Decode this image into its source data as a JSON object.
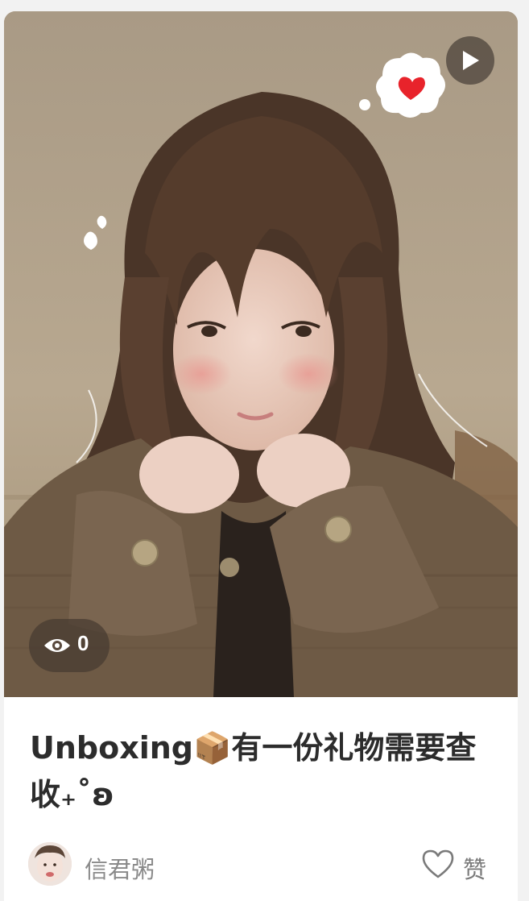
{
  "post": {
    "title": "Unboxing📦有一份礼物需要查收₊˚ʚ",
    "views": "0",
    "author_name": "信君粥",
    "like_label": "赞"
  },
  "icons": {
    "play": "play-icon",
    "views": "eye-icon",
    "like": "heart-outline-icon",
    "sticker_heart": "heart-thought-bubble-sticker"
  },
  "colors": {
    "title_text": "#2c2c2c",
    "meta_text": "#8a8a8a",
    "overlay_dark": "#463a30",
    "sticker_heart": "#e8232b"
  }
}
